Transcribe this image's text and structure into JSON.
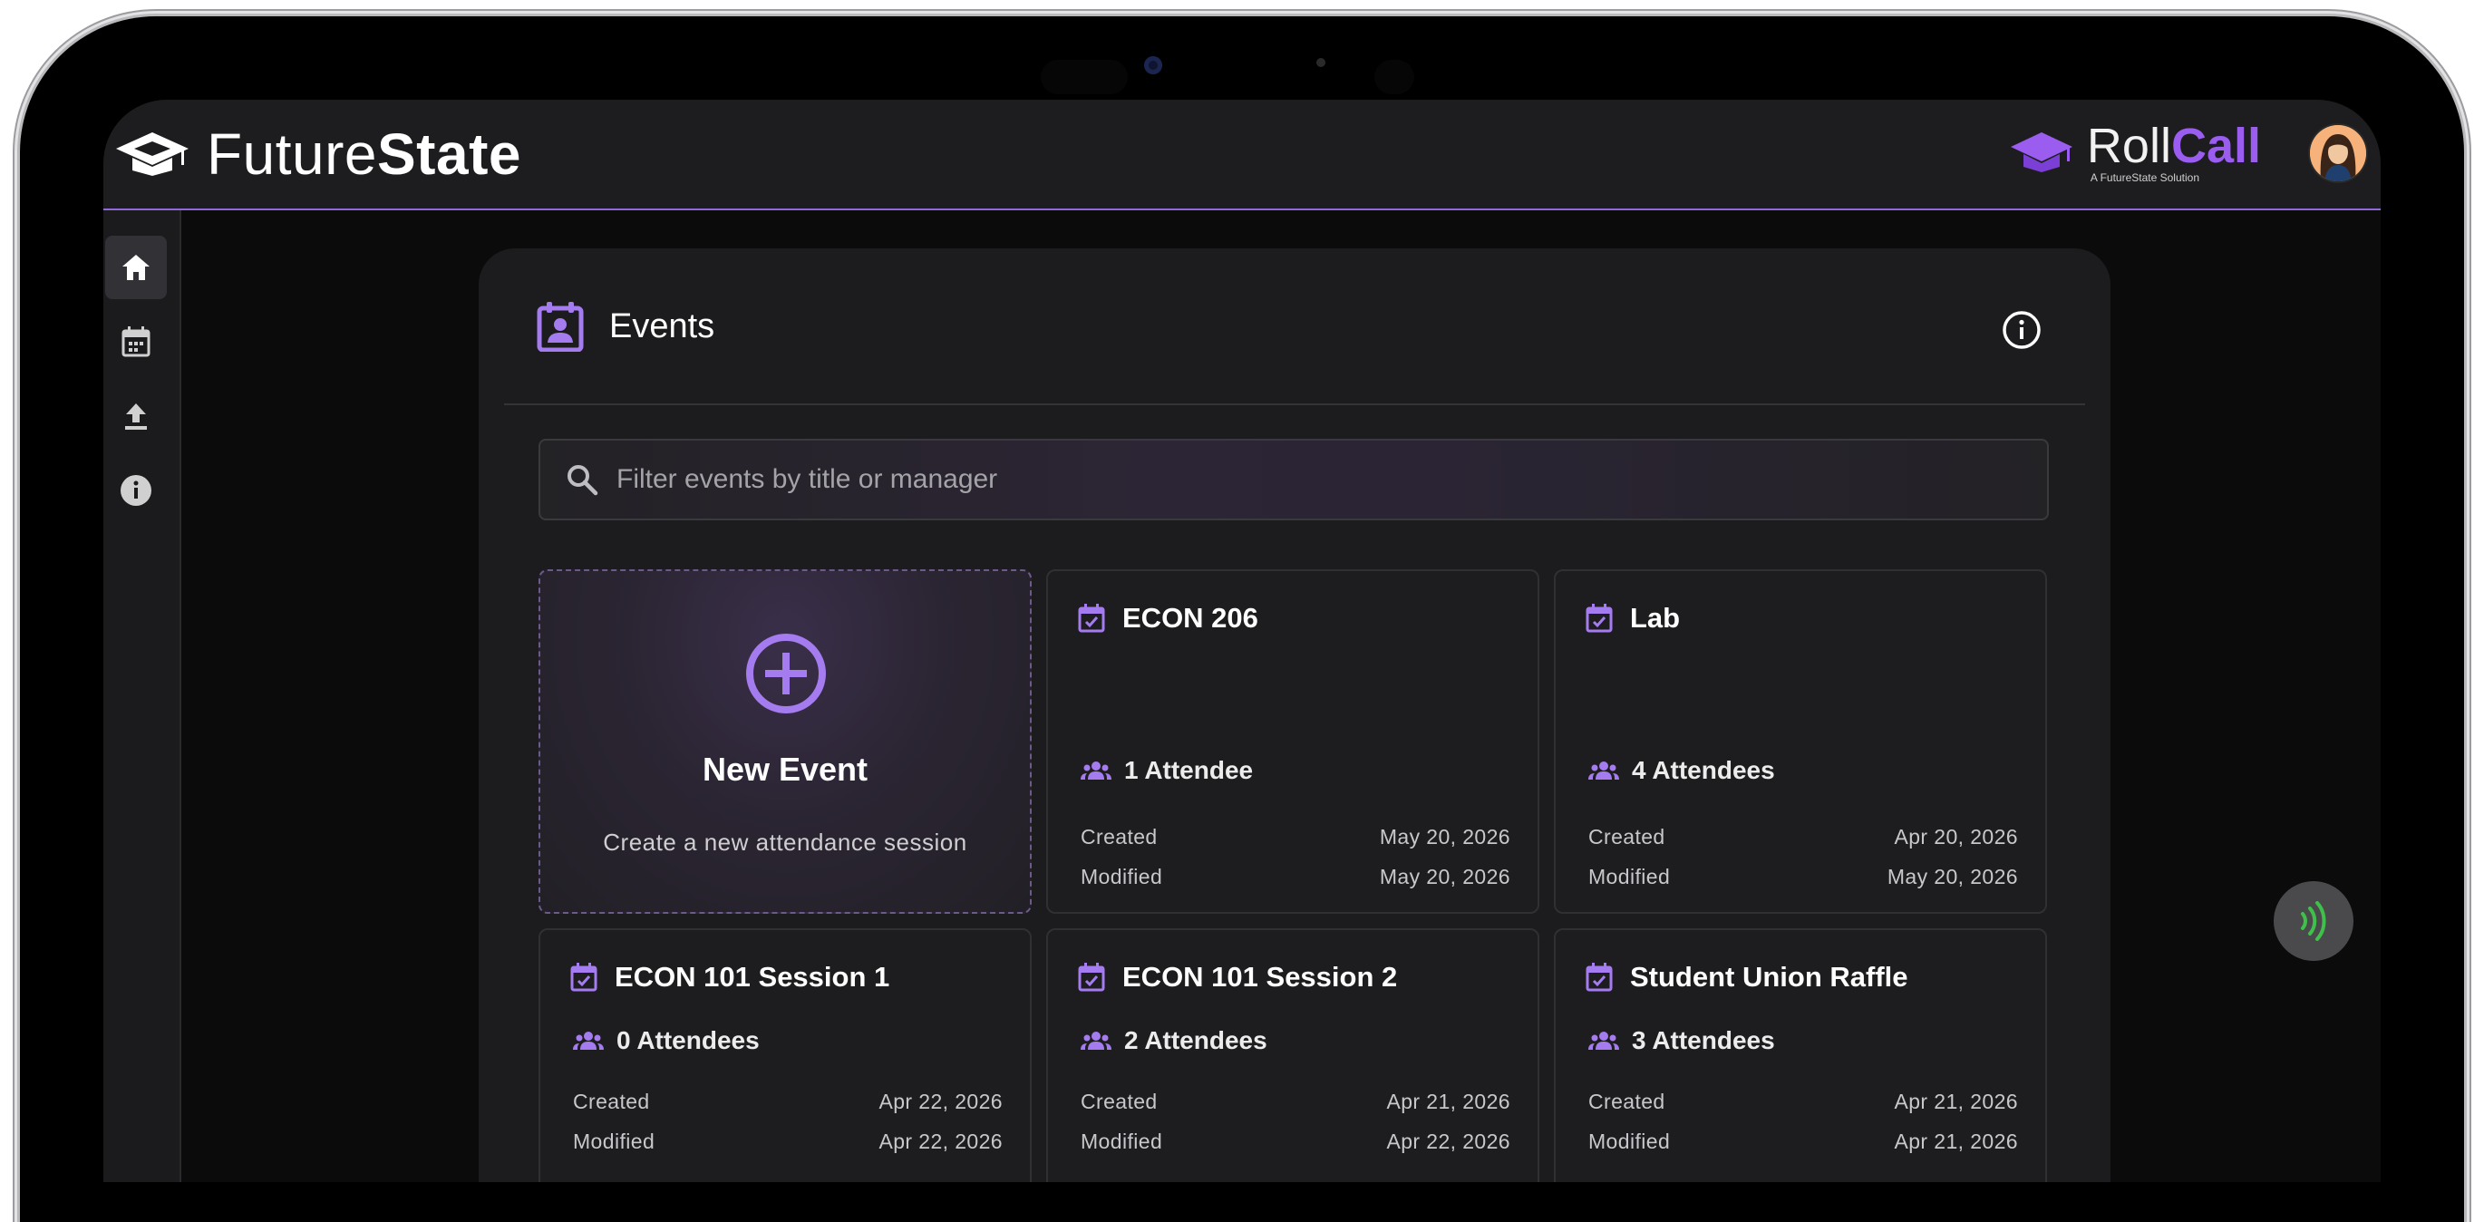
{
  "brand": {
    "name_light": "Future",
    "name_bold": "State"
  },
  "product": {
    "name_light": "Roll",
    "name_bold": "Call",
    "tagline": "A FutureState Solution"
  },
  "sidebar": {
    "items": [
      {
        "label": "home",
        "icon": "home-icon",
        "active": true
      },
      {
        "label": "calendar",
        "icon": "calendar-icon",
        "active": false
      },
      {
        "label": "upload",
        "icon": "upload-icon",
        "active": false
      },
      {
        "label": "info",
        "icon": "info-icon",
        "active": false
      }
    ]
  },
  "events": {
    "title": "Events",
    "search_placeholder": "Filter events by title or manager",
    "search_value": "",
    "new_event": {
      "title": "New Event",
      "subtitle": "Create a new attendance session"
    },
    "created_label": "Created",
    "modified_label": "Modified",
    "cards": [
      {
        "title": "ECON 206",
        "attendees": "1 Attendee",
        "created": "May 20, 2026",
        "modified": "May 20, 2026"
      },
      {
        "title": "Lab",
        "attendees": "4 Attendees",
        "created": "Apr 20, 2026",
        "modified": "May 20, 2026"
      },
      {
        "title": "ECON 101 Session 1",
        "attendees": "0 Attendees",
        "created": "Apr 22, 2026",
        "modified": "Apr 22, 2026"
      },
      {
        "title": "ECON 101 Session 2",
        "attendees": "2 Attendees",
        "created": "Apr 21, 2026",
        "modified": "Apr 22, 2026"
      },
      {
        "title": "Student Union Raffle",
        "attendees": "3 Attendees",
        "created": "Apr 21, 2026",
        "modified": "Apr 21, 2026"
      }
    ]
  },
  "colors": {
    "accent": "#9b5df0",
    "topbar": "#1d1d1f",
    "background": "#0b0b0b",
    "card": "#1d1d1f",
    "nfc": "#3ec04a"
  }
}
